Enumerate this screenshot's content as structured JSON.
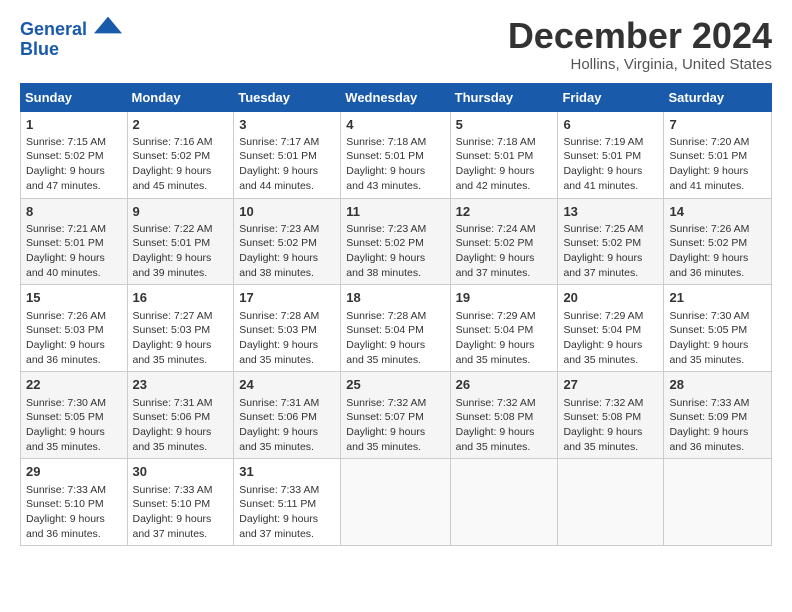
{
  "header": {
    "logo_line1": "General",
    "logo_line2": "Blue",
    "month_title": "December 2024",
    "location": "Hollins, Virginia, United States"
  },
  "days_of_week": [
    "Sunday",
    "Monday",
    "Tuesday",
    "Wednesday",
    "Thursday",
    "Friday",
    "Saturday"
  ],
  "weeks": [
    [
      {
        "day": "1",
        "sunrise": "7:15 AM",
        "sunset": "5:02 PM",
        "daylight": "9 hours and 47 minutes."
      },
      {
        "day": "2",
        "sunrise": "7:16 AM",
        "sunset": "5:02 PM",
        "daylight": "9 hours and 45 minutes."
      },
      {
        "day": "3",
        "sunrise": "7:17 AM",
        "sunset": "5:01 PM",
        "daylight": "9 hours and 44 minutes."
      },
      {
        "day": "4",
        "sunrise": "7:18 AM",
        "sunset": "5:01 PM",
        "daylight": "9 hours and 43 minutes."
      },
      {
        "day": "5",
        "sunrise": "7:18 AM",
        "sunset": "5:01 PM",
        "daylight": "9 hours and 42 minutes."
      },
      {
        "day": "6",
        "sunrise": "7:19 AM",
        "sunset": "5:01 PM",
        "daylight": "9 hours and 41 minutes."
      },
      {
        "day": "7",
        "sunrise": "7:20 AM",
        "sunset": "5:01 PM",
        "daylight": "9 hours and 41 minutes."
      }
    ],
    [
      {
        "day": "8",
        "sunrise": "7:21 AM",
        "sunset": "5:01 PM",
        "daylight": "9 hours and 40 minutes."
      },
      {
        "day": "9",
        "sunrise": "7:22 AM",
        "sunset": "5:01 PM",
        "daylight": "9 hours and 39 minutes."
      },
      {
        "day": "10",
        "sunrise": "7:23 AM",
        "sunset": "5:02 PM",
        "daylight": "9 hours and 38 minutes."
      },
      {
        "day": "11",
        "sunrise": "7:23 AM",
        "sunset": "5:02 PM",
        "daylight": "9 hours and 38 minutes."
      },
      {
        "day": "12",
        "sunrise": "7:24 AM",
        "sunset": "5:02 PM",
        "daylight": "9 hours and 37 minutes."
      },
      {
        "day": "13",
        "sunrise": "7:25 AM",
        "sunset": "5:02 PM",
        "daylight": "9 hours and 37 minutes."
      },
      {
        "day": "14",
        "sunrise": "7:26 AM",
        "sunset": "5:02 PM",
        "daylight": "9 hours and 36 minutes."
      }
    ],
    [
      {
        "day": "15",
        "sunrise": "7:26 AM",
        "sunset": "5:03 PM",
        "daylight": "9 hours and 36 minutes."
      },
      {
        "day": "16",
        "sunrise": "7:27 AM",
        "sunset": "5:03 PM",
        "daylight": "9 hours and 35 minutes."
      },
      {
        "day": "17",
        "sunrise": "7:28 AM",
        "sunset": "5:03 PM",
        "daylight": "9 hours and 35 minutes."
      },
      {
        "day": "18",
        "sunrise": "7:28 AM",
        "sunset": "5:04 PM",
        "daylight": "9 hours and 35 minutes."
      },
      {
        "day": "19",
        "sunrise": "7:29 AM",
        "sunset": "5:04 PM",
        "daylight": "9 hours and 35 minutes."
      },
      {
        "day": "20",
        "sunrise": "7:29 AM",
        "sunset": "5:04 PM",
        "daylight": "9 hours and 35 minutes."
      },
      {
        "day": "21",
        "sunrise": "7:30 AM",
        "sunset": "5:05 PM",
        "daylight": "9 hours and 35 minutes."
      }
    ],
    [
      {
        "day": "22",
        "sunrise": "7:30 AM",
        "sunset": "5:05 PM",
        "daylight": "9 hours and 35 minutes."
      },
      {
        "day": "23",
        "sunrise": "7:31 AM",
        "sunset": "5:06 PM",
        "daylight": "9 hours and 35 minutes."
      },
      {
        "day": "24",
        "sunrise": "7:31 AM",
        "sunset": "5:06 PM",
        "daylight": "9 hours and 35 minutes."
      },
      {
        "day": "25",
        "sunrise": "7:32 AM",
        "sunset": "5:07 PM",
        "daylight": "9 hours and 35 minutes."
      },
      {
        "day": "26",
        "sunrise": "7:32 AM",
        "sunset": "5:08 PM",
        "daylight": "9 hours and 35 minutes."
      },
      {
        "day": "27",
        "sunrise": "7:32 AM",
        "sunset": "5:08 PM",
        "daylight": "9 hours and 35 minutes."
      },
      {
        "day": "28",
        "sunrise": "7:33 AM",
        "sunset": "5:09 PM",
        "daylight": "9 hours and 36 minutes."
      }
    ],
    [
      {
        "day": "29",
        "sunrise": "7:33 AM",
        "sunset": "5:10 PM",
        "daylight": "9 hours and 36 minutes."
      },
      {
        "day": "30",
        "sunrise": "7:33 AM",
        "sunset": "5:10 PM",
        "daylight": "9 hours and 37 minutes."
      },
      {
        "day": "31",
        "sunrise": "7:33 AM",
        "sunset": "5:11 PM",
        "daylight": "9 hours and 37 minutes."
      },
      null,
      null,
      null,
      null
    ]
  ]
}
